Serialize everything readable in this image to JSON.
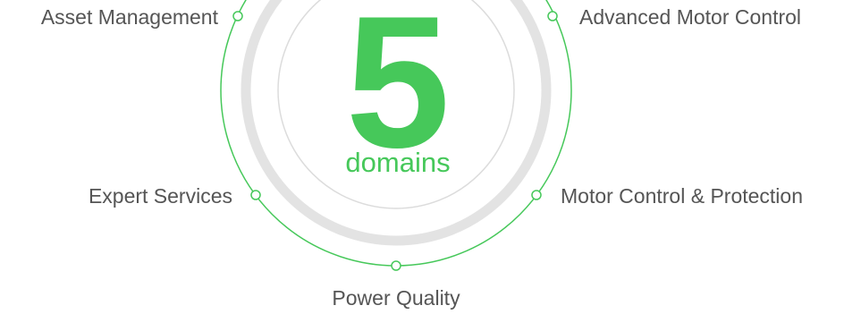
{
  "center": {
    "count": "5",
    "unit": "domains"
  },
  "domains": [
    {
      "label": "Asset Management"
    },
    {
      "label": "Advanced Motor Control"
    },
    {
      "label": "Expert Services"
    },
    {
      "label": "Motor Control & Protection"
    },
    {
      "label": "Power Quality"
    }
  ],
  "colors": {
    "accent": "#46c85a",
    "ring_gray": "#e3e3e3",
    "label_gray": "#555555"
  }
}
